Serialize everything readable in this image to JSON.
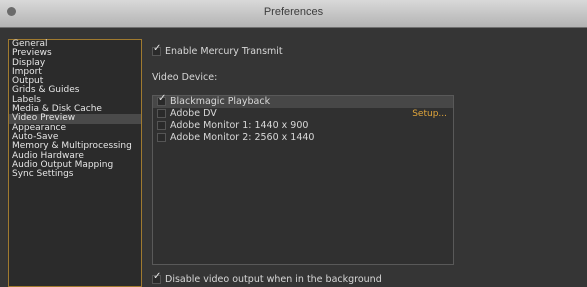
{
  "window": {
    "title": "Preferences"
  },
  "sidebar": {
    "items": [
      {
        "label": "General"
      },
      {
        "label": "Previews"
      },
      {
        "label": "Display"
      },
      {
        "label": "Import"
      },
      {
        "label": "Output"
      },
      {
        "label": "Grids & Guides"
      },
      {
        "label": "Labels"
      },
      {
        "label": "Media & Disk Cache"
      },
      {
        "label": "Video Preview"
      },
      {
        "label": "Appearance"
      },
      {
        "label": "Auto-Save"
      },
      {
        "label": "Memory & Multiprocessing"
      },
      {
        "label": "Audio Hardware"
      },
      {
        "label": "Audio Output Mapping"
      },
      {
        "label": "Sync Settings"
      }
    ],
    "selected": "Video Preview"
  },
  "video_preview": {
    "enable_mercury_transmit": {
      "label": "Enable Mercury Transmit",
      "checked": true
    },
    "video_device_label": "Video Device:",
    "devices": [
      {
        "label": "Blackmagic Playback",
        "checked": true,
        "selected": true
      },
      {
        "label": "Adobe DV",
        "checked": false,
        "setup_label": "Setup..."
      },
      {
        "label": "Adobe Monitor 1: 1440 x 900",
        "checked": false
      },
      {
        "label": "Adobe Monitor 2: 2560 x 1440",
        "checked": false
      }
    ],
    "disable_background_output": {
      "label": "Disable video output when in the background",
      "checked": true
    }
  },
  "colors": {
    "accent": "#a07a2f",
    "link": "#e2a63b",
    "panel_bg": "#353535"
  }
}
